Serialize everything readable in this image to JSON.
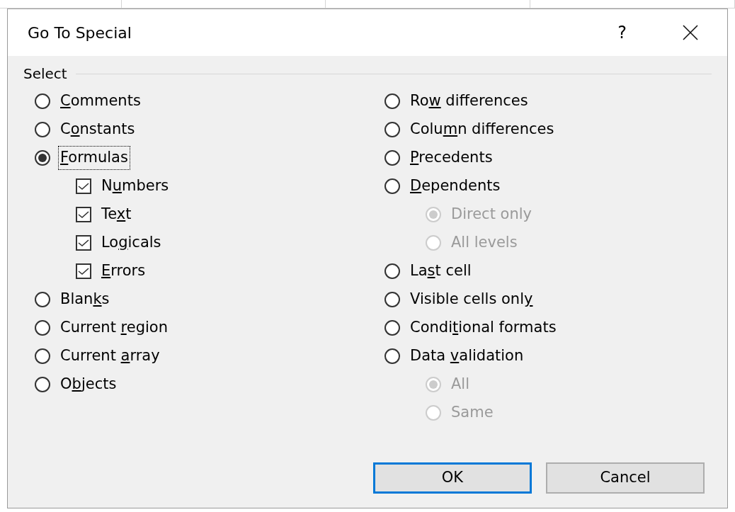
{
  "window": {
    "title": "Go To Special",
    "help": "?"
  },
  "group": {
    "title": "Select"
  },
  "left_options": [
    {
      "kind": "radio",
      "key": "C",
      "post": "omments",
      "selected": false,
      "focused": false,
      "disabled": false
    },
    {
      "kind": "radio",
      "pre": "C",
      "key": "o",
      "post": "nstants",
      "selected": false,
      "focused": false,
      "disabled": false
    },
    {
      "kind": "radio",
      "key": "F",
      "post": "ormulas",
      "selected": true,
      "focused": true,
      "disabled": false,
      "children": [
        {
          "kind": "checkbox",
          "pre": "N",
          "key": "u",
          "post": "mbers",
          "checked": true
        },
        {
          "kind": "checkbox",
          "pre": "Te",
          "key": "x",
          "post": "t",
          "checked": true
        },
        {
          "kind": "checkbox",
          "pre": "Lo",
          "key": "g",
          "post": "icals",
          "checked": true
        },
        {
          "kind": "checkbox",
          "key": "E",
          "post": "rrors",
          "checked": true
        }
      ]
    },
    {
      "kind": "radio",
      "pre": "Blan",
      "key": "k",
      "post": "s",
      "selected": false,
      "focused": false,
      "disabled": false
    },
    {
      "kind": "radio",
      "pre": "Current ",
      "key": "r",
      "post": "egion",
      "selected": false,
      "focused": false,
      "disabled": false
    },
    {
      "kind": "radio",
      "pre": "Current ",
      "key": "a",
      "post": "rray",
      "selected": false,
      "focused": false,
      "disabled": false
    },
    {
      "kind": "radio",
      "pre": "O",
      "key": "b",
      "post": "jects",
      "selected": false,
      "focused": false,
      "disabled": false
    }
  ],
  "right_options": [
    {
      "kind": "radio",
      "pre": "Ro",
      "key": "w",
      "post": " differences",
      "selected": false,
      "focused": false,
      "disabled": false
    },
    {
      "kind": "radio",
      "pre": "Colu",
      "key": "m",
      "post": "n differences",
      "selected": false,
      "focused": false,
      "disabled": false
    },
    {
      "kind": "radio",
      "key": "P",
      "post": "recedents",
      "selected": false,
      "focused": false,
      "disabled": false
    },
    {
      "kind": "radio",
      "key": "D",
      "post": "ependents",
      "selected": false,
      "focused": false,
      "disabled": false,
      "children": [
        {
          "kind": "radio",
          "pre": "Direct only",
          "selected": true,
          "focused": false,
          "disabled": true
        },
        {
          "kind": "radio",
          "pre": "All levels",
          "selected": false,
          "focused": false,
          "disabled": true
        }
      ]
    },
    {
      "kind": "radio",
      "pre": "La",
      "key": "s",
      "post": "t cell",
      "selected": false,
      "focused": false,
      "disabled": false
    },
    {
      "kind": "radio",
      "pre": "Visible cells onl",
      "key": "y",
      "selected": false,
      "focused": false,
      "disabled": false
    },
    {
      "kind": "radio",
      "pre": "Condi",
      "key": "t",
      "post": "ional formats",
      "selected": false,
      "focused": false,
      "disabled": false
    },
    {
      "kind": "radio",
      "pre": "Data ",
      "key": "v",
      "post": "alidation",
      "selected": false,
      "focused": false,
      "disabled": false,
      "children": [
        {
          "kind": "radio",
          "pre": "All",
          "selected": true,
          "focused": false,
          "disabled": true
        },
        {
          "kind": "radio",
          "pre": "Same",
          "selected": false,
          "focused": false,
          "disabled": true
        }
      ]
    }
  ],
  "buttons": [
    {
      "label": "OK",
      "default": true
    },
    {
      "label": "Cancel",
      "default": false
    }
  ]
}
